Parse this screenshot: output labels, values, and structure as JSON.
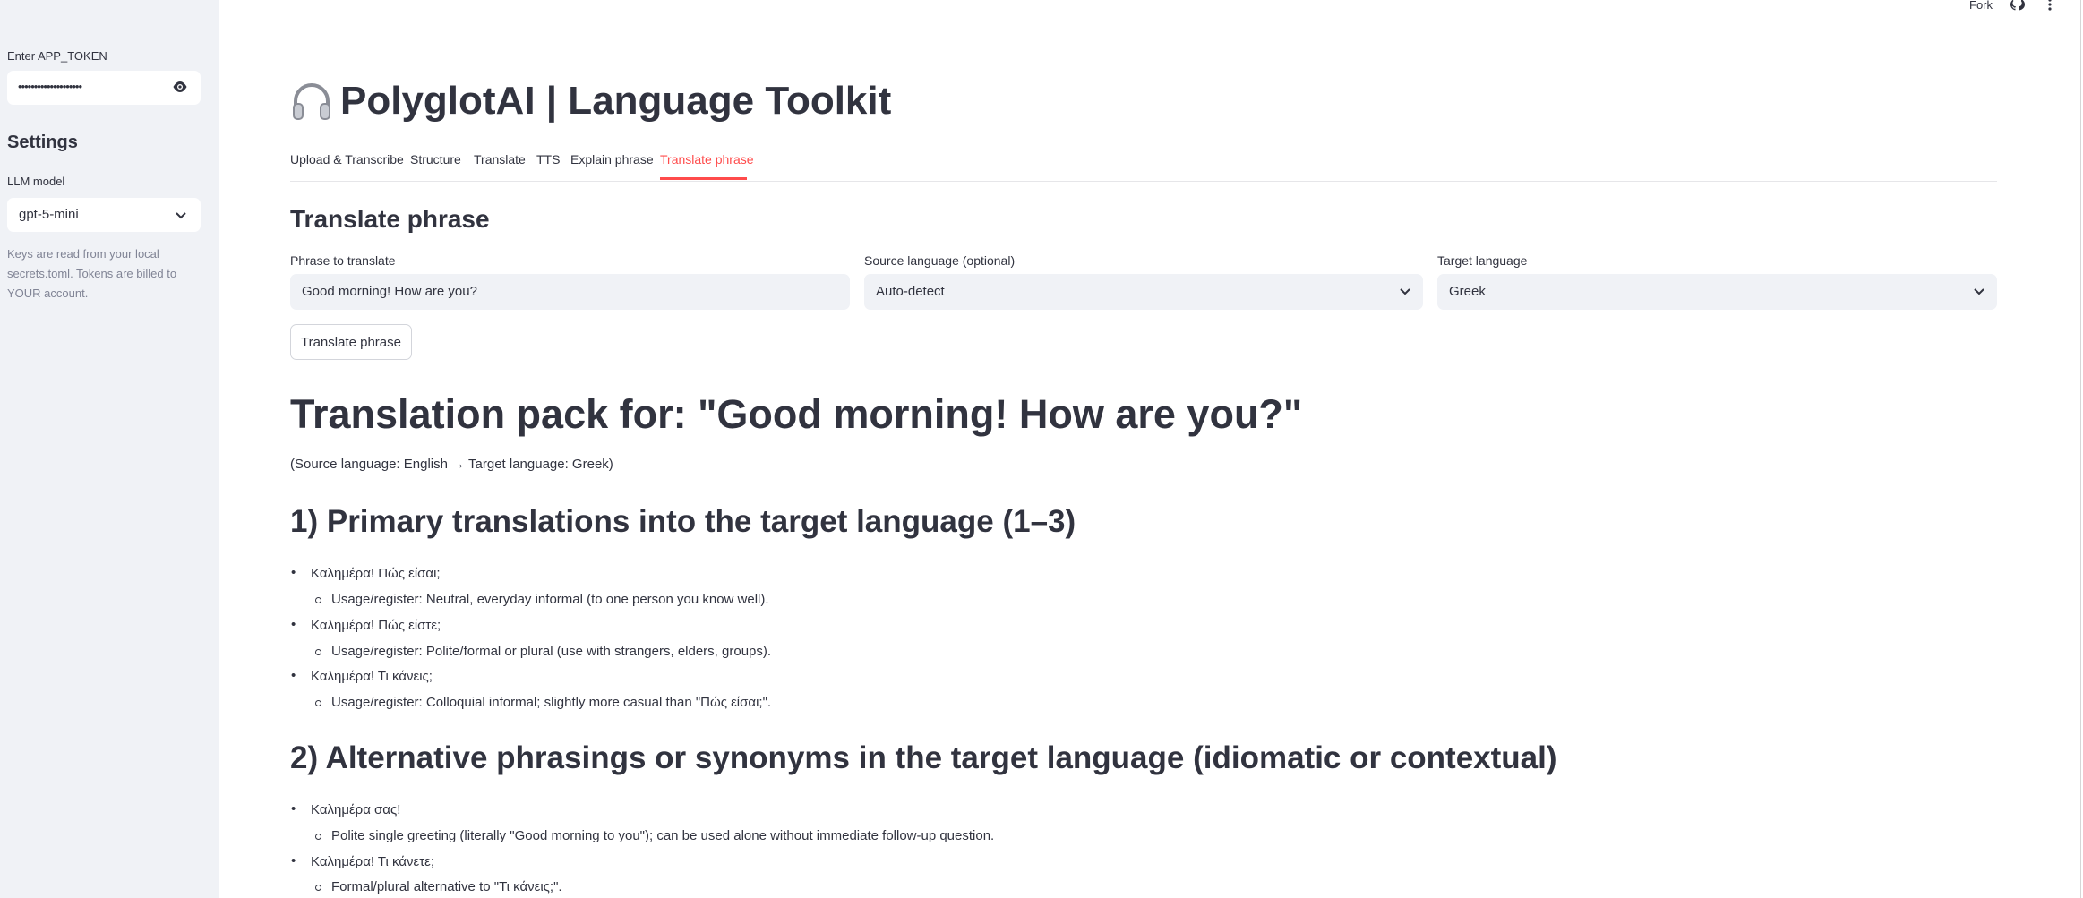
{
  "sidebar": {
    "token_label": "Enter APP_TOKEN",
    "token_value": "••••••••••••••••••••",
    "settings_heading": "Settings",
    "llm_label": "LLM model",
    "llm_value": "gpt-5-mini",
    "note": "Keys are read from your local secrets.toml. Tokens are billed to YOUR account."
  },
  "topbar": {
    "fork": "Fork"
  },
  "app": {
    "title": "PolyglotAI | Language Toolkit",
    "tabs": [
      "Upload & Transcribe",
      "Structure",
      "Translate",
      "TTS",
      "Explain phrase",
      "Translate phrase"
    ],
    "active_tab": "Translate phrase"
  },
  "form": {
    "heading": "Translate phrase",
    "phrase_label": "Phrase to translate",
    "phrase_value": "Good morning! How are you?",
    "source_label": "Source language (optional)",
    "source_value": "Auto-detect",
    "target_label": "Target language",
    "target_value": "Greek",
    "button": "Translate phrase"
  },
  "result": {
    "title": "Translation pack for: \"Good morning! How are you?\"",
    "languages": "(Source language: English → Target language: Greek)",
    "section1": {
      "heading": "1) Primary translations into the target language (1–3)",
      "items": [
        {
          "text": "Καλημέρα! Πώς είσαι;",
          "sub": "Usage/register: Neutral, everyday informal (to one person you know well)."
        },
        {
          "text": "Καλημέρα! Πώς είστε;",
          "sub": "Usage/register: Polite/formal or plural (use with strangers, elders, groups)."
        },
        {
          "text": "Καλημέρα! Τι κάνεις;",
          "sub": "Usage/register: Colloquial informal; slightly more casual than \"Πώς είσαι;\"."
        }
      ]
    },
    "section2": {
      "heading": "2) Alternative phrasings or synonyms in the target language (idiomatic or contextual)",
      "items": [
        {
          "text": "Καλημέρα σας!",
          "sub": "Polite single greeting (literally \"Good morning to you\"); can be used alone without immediate follow-up question."
        },
        {
          "text": "Καλημέρα! Τι κάνετε;",
          "sub": "Formal/plural alternative to \"Τι κάνεις;\"."
        }
      ]
    }
  }
}
